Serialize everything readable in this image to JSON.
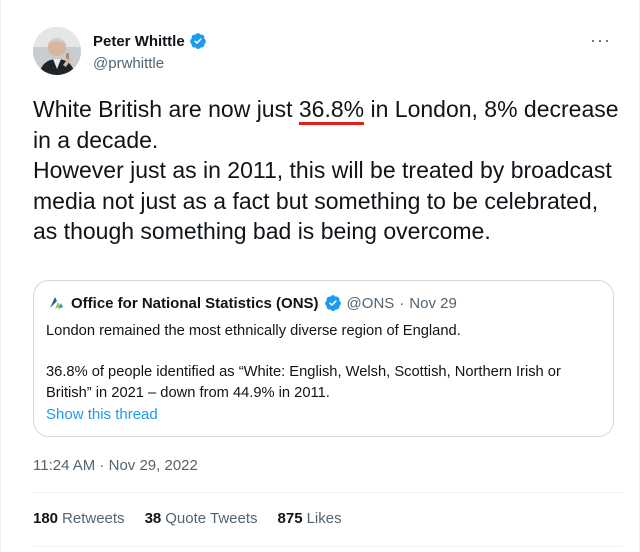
{
  "author": {
    "display_name": "Peter Whittle",
    "handle": "@prwhittle"
  },
  "more_glyph": "···",
  "tweet_text": {
    "part1": "White British are now just ",
    "highlight": "36.8%",
    "part2": " in London, 8% decrease in a decade.",
    "paragraph2": "However just as in 2011, this will be treated by broadcast media not just as a fact but something to be celebrated, as though something bad is being overcome."
  },
  "quoted_tweet": {
    "name": "Office for National Statistics (ONS)",
    "handle": "@ONS",
    "separator": "·",
    "date": "Nov 29",
    "paragraph1": "London remained the most ethnically diverse region of England.",
    "paragraph2": "36.8% of people identified as “White: English, Welsh, Scottish, Northern Irish or British” in 2021 – down from 44.9% in 2011.",
    "thread_link": "Show this thread"
  },
  "timestamp": {
    "time": "11:24 AM",
    "separator": " · ",
    "date": "Nov 29, 2022"
  },
  "stats": {
    "retweets_count": "180",
    "retweets_label": "Retweets",
    "quotes_count": "38",
    "quotes_label": "Quote Tweets",
    "likes_count": "875",
    "likes_label": "Likes"
  },
  "colors": {
    "text_primary": "#0f1419",
    "text_secondary": "#536471",
    "link": "#1d9bf0",
    "highlight_underline": "#e0201b",
    "verified": "#1d9bf0",
    "border": "#cfd9de"
  },
  "icons": {
    "verified": "verified-badge-icon",
    "ons_logo": "ons-logo-icon",
    "more": "more-options-icon"
  }
}
